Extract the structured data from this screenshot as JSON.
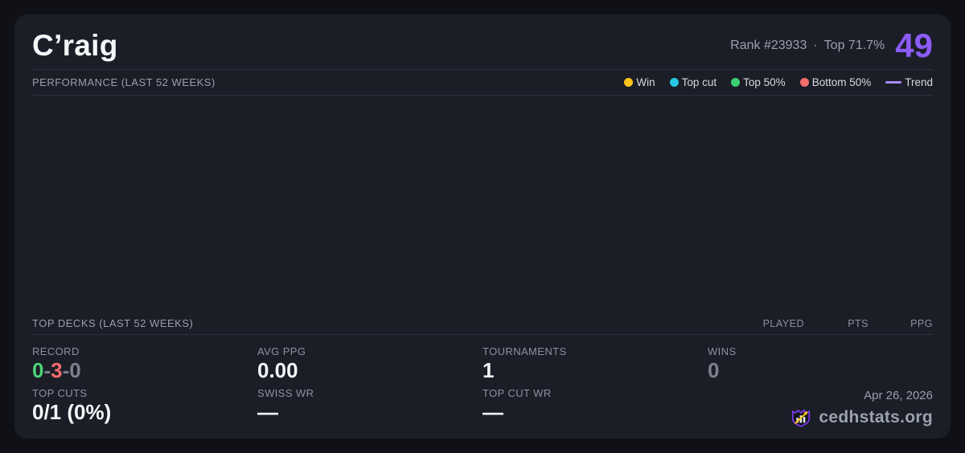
{
  "colors": {
    "page_background": "#101117",
    "card_background": "#1b1d27",
    "divider": "#2c3140",
    "accent_purple": "#8b5cf6",
    "record_win_green": "#4cd377",
    "record_loss_red": "#f56c6c",
    "muted_gray": "#7b828d",
    "logo_outline_purple": "#7c3aed",
    "logo_arrow_yellow": "#fcc419"
  },
  "header": {
    "title": "C’raig",
    "rank_text": "Rank #23933",
    "separator": "·",
    "top_percent_text": "Top 71.7%",
    "score": "49"
  },
  "performance": {
    "section_title": "PERFORMANCE (LAST 52 WEEKS)",
    "legend": [
      {
        "label": "Win",
        "color": "#fcc419",
        "marker": "dot"
      },
      {
        "label": "Top cut",
        "color": "#25c8e0",
        "marker": "dot"
      },
      {
        "label": "Top 50%",
        "color": "#3bcf73",
        "marker": "dot"
      },
      {
        "label": "Bottom 50%",
        "color": "#f56c6c",
        "marker": "dot"
      },
      {
        "label": "Trend",
        "color": "#a78bfa",
        "marker": "line"
      }
    ],
    "chart_data": {
      "type": "scatter",
      "points": [],
      "note": "no games plotted in the last 52 weeks window"
    }
  },
  "top_decks": {
    "section_title": "TOP DECKS (LAST 52 WEEKS)",
    "columns": [
      "PLAYED",
      "PTS",
      "PPG"
    ],
    "rows": []
  },
  "stats": {
    "record": {
      "label": "RECORD",
      "wins": "0",
      "losses": "3",
      "draws": "0",
      "separator": "-"
    },
    "avg_ppg": {
      "label": "AVG PPG",
      "value": "0.00"
    },
    "tournaments": {
      "label": "TOURNAMENTS",
      "value": "1"
    },
    "wins": {
      "label": "WINS",
      "value": "0"
    },
    "top_cuts": {
      "label": "TOP CUTS",
      "value": "0/1 (0%)"
    },
    "swiss_wr": {
      "label": "SWISS WR",
      "value": "—"
    },
    "top_cut_wr": {
      "label": "TOP CUT WR",
      "value": "—"
    }
  },
  "footer": {
    "date": "Apr 26, 2026",
    "brand": "cedhstats.org"
  }
}
